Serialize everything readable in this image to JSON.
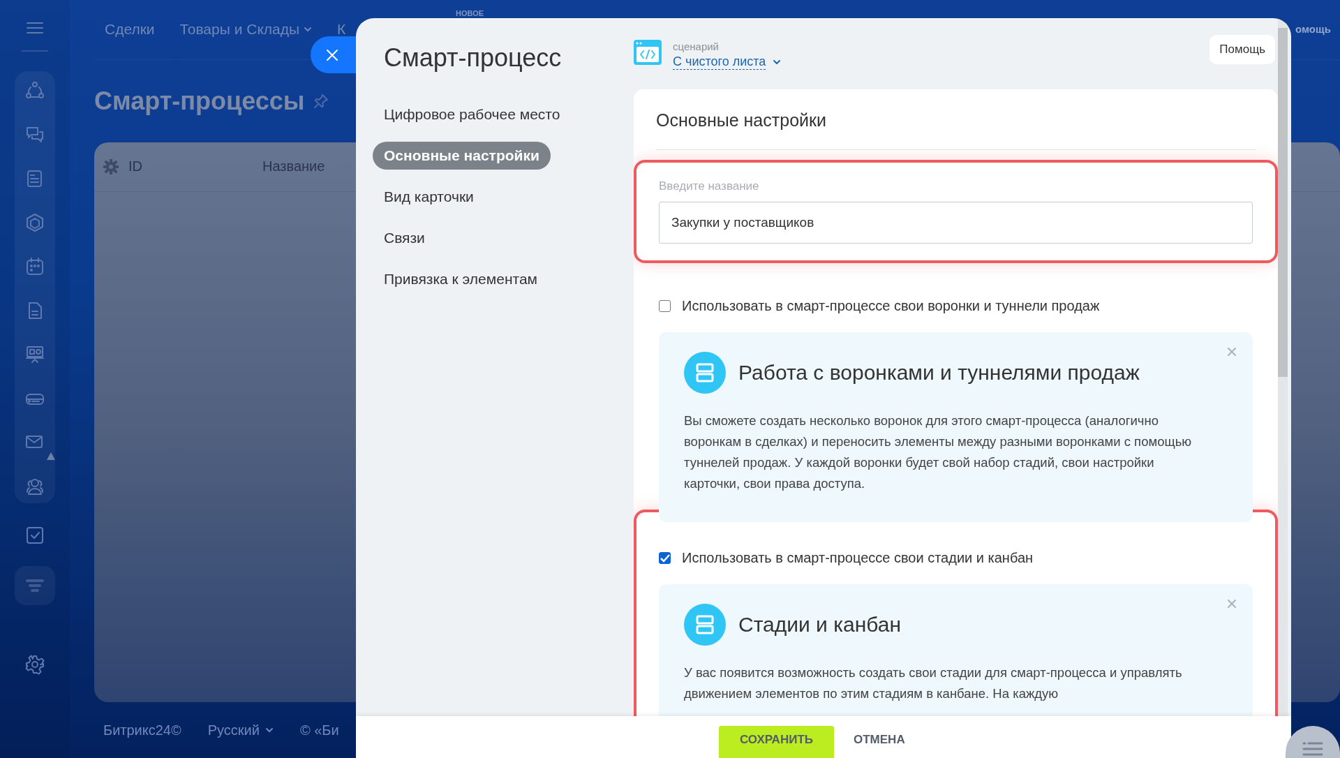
{
  "top_nav": {
    "items": [
      {
        "label": "Сделки",
        "dropdown": false
      },
      {
        "label": "Товары и Склады",
        "dropdown": true
      },
      {
        "label": "К",
        "dropdown": false
      }
    ],
    "new_badge": "НОВОЕ",
    "help": "омощь"
  },
  "page": {
    "title": "Смарт-процессы"
  },
  "table": {
    "columns": [
      "ID",
      "Название"
    ]
  },
  "footer": {
    "items": [
      {
        "label": "Битрикс24©",
        "dropdown": false
      },
      {
        "label": "Русский",
        "dropdown": true
      },
      {
        "label": "© «Би",
        "dropdown": false
      }
    ]
  },
  "modal": {
    "title": "Смарт-процесс",
    "nav": [
      {
        "label": "Цифровое рабочее место",
        "selected": false
      },
      {
        "label": "Основные настройки",
        "selected": true
      },
      {
        "label": "Вид карточки",
        "selected": false
      },
      {
        "label": "Связи",
        "selected": false
      },
      {
        "label": "Привязка к элементам",
        "selected": false
      }
    ],
    "scenario": {
      "label": "сценарий",
      "value": "С чистого листа"
    },
    "help_button": "Помощь",
    "section_title": "Основные настройки",
    "name_field": {
      "label": "Введите название",
      "value": "Закупки у поставщиков",
      "highlighted": true
    },
    "options": [
      {
        "label": "Использовать в смарт-процессе свои воронки и туннели продаж",
        "checked": false,
        "highlighted": false,
        "info": {
          "title": "Работа с воронками и туннелями продаж",
          "text": "Вы сможете создать несколько воронок для этого смарт-процесса (аналогично воронкам в сделках) и переносить элементы между разными воронками с помощью туннелей продаж. У каждой воронки будет свой набор стадий, свои настройки карточки, свои права доступа."
        }
      },
      {
        "label": "Использовать в смарт-процессе свои стадии и канбан",
        "checked": true,
        "highlighted": true,
        "info": {
          "title": "Стадии и канбан",
          "text": "У вас появится возможность создать свои стадии для смарт-процесса и управлять движением элементов по этим стадиям в канбане. На каждую"
        }
      }
    ],
    "buttons": [
      {
        "label": "СОХРАНИТЬ",
        "kind": "primary"
      },
      {
        "label": "ОТМЕНА",
        "kind": "link"
      }
    ]
  }
}
